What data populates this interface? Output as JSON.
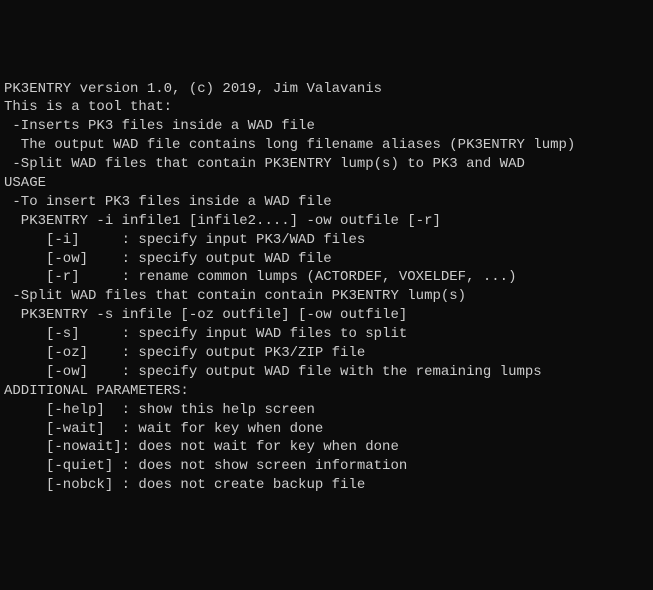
{
  "lines": [
    "PK3ENTRY version 1.0, (c) 2019, Jim Valavanis",
    "This is a tool that:",
    " -Inserts PK3 files inside a WAD file",
    "  The output WAD file contains long filename aliases (PK3ENTRY lump)",
    " -Split WAD files that contain PK3ENTRY lump(s) to PK3 and WAD",
    "",
    "USAGE",
    " -To insert PK3 files inside a WAD file",
    "  PK3ENTRY -i infile1 [infile2....] -ow outfile [-r]",
    "     [-i]     : specify input PK3/WAD files",
    "     [-ow]    : specify output WAD file",
    "     [-r]     : rename common lumps (ACTORDEF, VOXELDEF, ...)",
    "",
    " -Split WAD files that contain contain PK3ENTRY lump(s)",
    "  PK3ENTRY -s infile [-oz outfile] [-ow outfile]",
    "     [-s]     : specify input WAD files to split",
    "     [-oz]    : specify output PK3/ZIP file",
    "     [-ow]    : specify output WAD file with the remaining lumps",
    "",
    "ADDITIONAL PARAMETERS:",
    "     [-help]  : show this help screen",
    "     [-wait]  : wait for key when done",
    "     [-nowait]: does not wait for key when done",
    "     [-quiet] : does not show screen information",
    "     [-nobck] : does not create backup file"
  ]
}
